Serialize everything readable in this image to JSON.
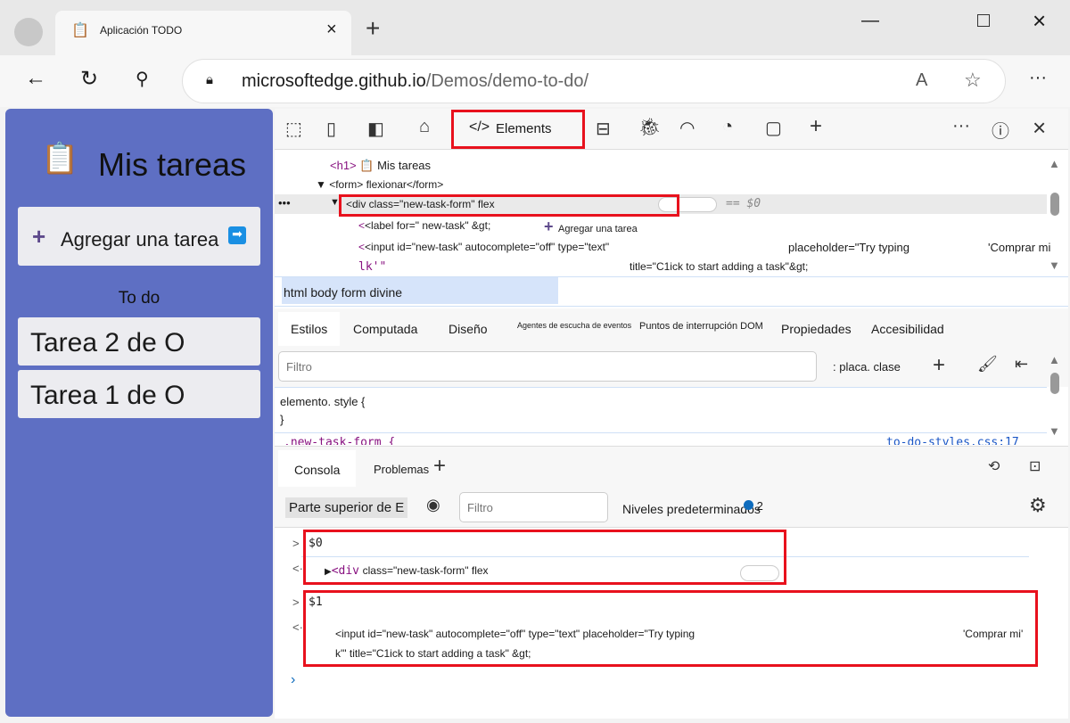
{
  "browser": {
    "tab_title": "Aplicación TODO",
    "url_domain": "microsoftedge.github.io",
    "url_path": "/Demos/demo-to-do/"
  },
  "app": {
    "title": "Mis tareas",
    "add_button": "Agregar una tarea",
    "section": "To do",
    "tasks": [
      "Tarea 2 de O",
      "Tarea 1 de O"
    ]
  },
  "devtools": {
    "tabs": {
      "elements": "Elements"
    },
    "dom": {
      "h1_tag": "<h1>",
      "h1_text": "Mis tareas",
      "form": "<form> flexionar</form>",
      "div": "<div class=\"new-task-form\" flex",
      "eq": "== $0",
      "label": "<label for=\" new-task\" &gt;",
      "label_text": "Agregar una tarea",
      "input": "<input id=\"new-task\" autocomplete=\"off\" type=\"text\"",
      "placeholder": "placeholder=\"Try typing",
      "placeholder2": "'Comprar mi",
      "lk": "lk'\"",
      "title_attr": "title=\"C1ick to start adding a task\"&gt;"
    },
    "breadcrumb": "html body form divine",
    "subtabs": [
      "Estilos",
      "Computada",
      "Diseño",
      "Agentes de escucha de eventos",
      "Puntos de interrupción DOM",
      "Propiedades",
      "Accesibilidad"
    ],
    "styles": {
      "filter_placeholder": "Filtro",
      "hov_cls": ": placa. clase",
      "element_style": "elemento. style {",
      "close_brace": "}",
      "rule": ".new-task-form {",
      "source": "to-do-styles.css:17"
    },
    "drawer": {
      "tabs": [
        "Consola",
        "Problemas"
      ],
      "context": "Parte superior de E",
      "filter_placeholder": "Filtro",
      "levels": "Niveles predeterminados",
      "badge": "2"
    },
    "console": {
      "in1": "$0",
      "out1_tag": "<div",
      "out1_text": "class=\"new-task-form\" flex",
      "in2": "$1",
      "out2_line1": "<input id=\"new-task\" autocomplete=\"off\" type=\"text\" placeholder=\"Try typing",
      "out2_line1b": "'Comprar mi'",
      "out2_line2": "k'\" title=\"C1ick to start adding a task\" &gt;"
    }
  },
  "colors": {
    "app_bg": "#5e6fc3",
    "highlight": "#e8111d",
    "accent": "#0f6cbd"
  }
}
